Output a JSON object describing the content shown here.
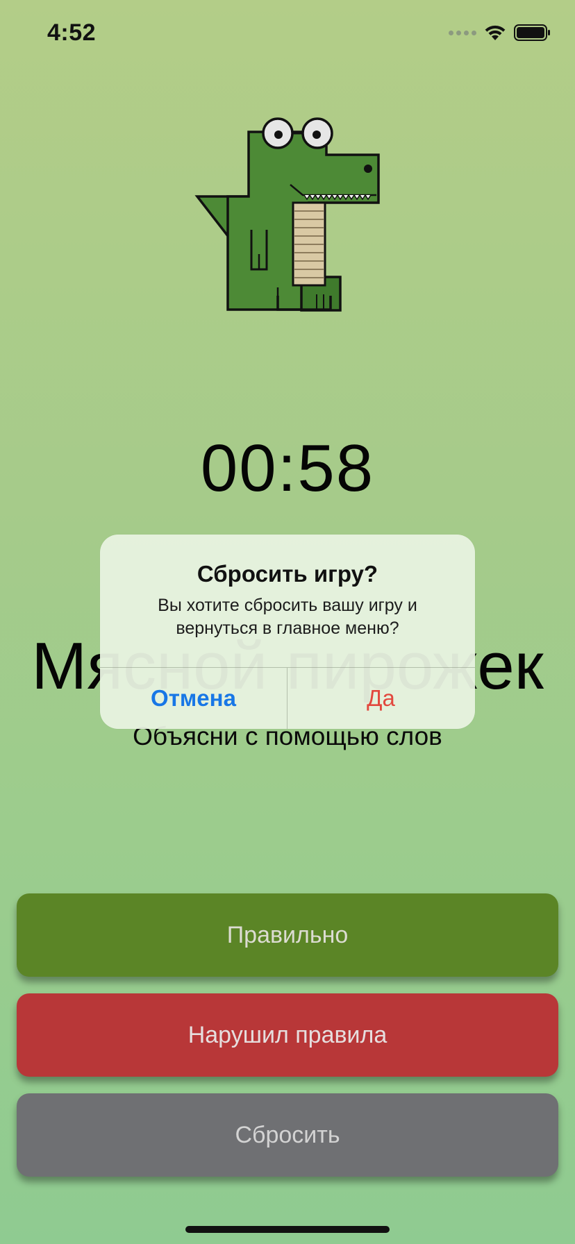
{
  "status_bar": {
    "time": "4:52"
  },
  "game": {
    "timer": "00:58",
    "word": "Мясной пирожек",
    "hint": "Объясни с помощью слов"
  },
  "alert": {
    "title": "Сбросить игру?",
    "message": "Вы хотите сбросить вашу игру и вернуться в главное меню?",
    "cancel_label": "Отмена",
    "confirm_label": "Да"
  },
  "actions": {
    "correct_label": "Правильно",
    "violation_label": "Нарушил правила",
    "reset_label": "Сбросить"
  },
  "colors": {
    "correct": "#5b8526",
    "violation": "#b83738",
    "reset": "#6f7073",
    "alert_cancel": "#1877e6",
    "alert_confirm": "#e2483e"
  },
  "icons": [
    "crocodile-mascot",
    "signal-icon",
    "wifi-icon",
    "battery-icon"
  ]
}
